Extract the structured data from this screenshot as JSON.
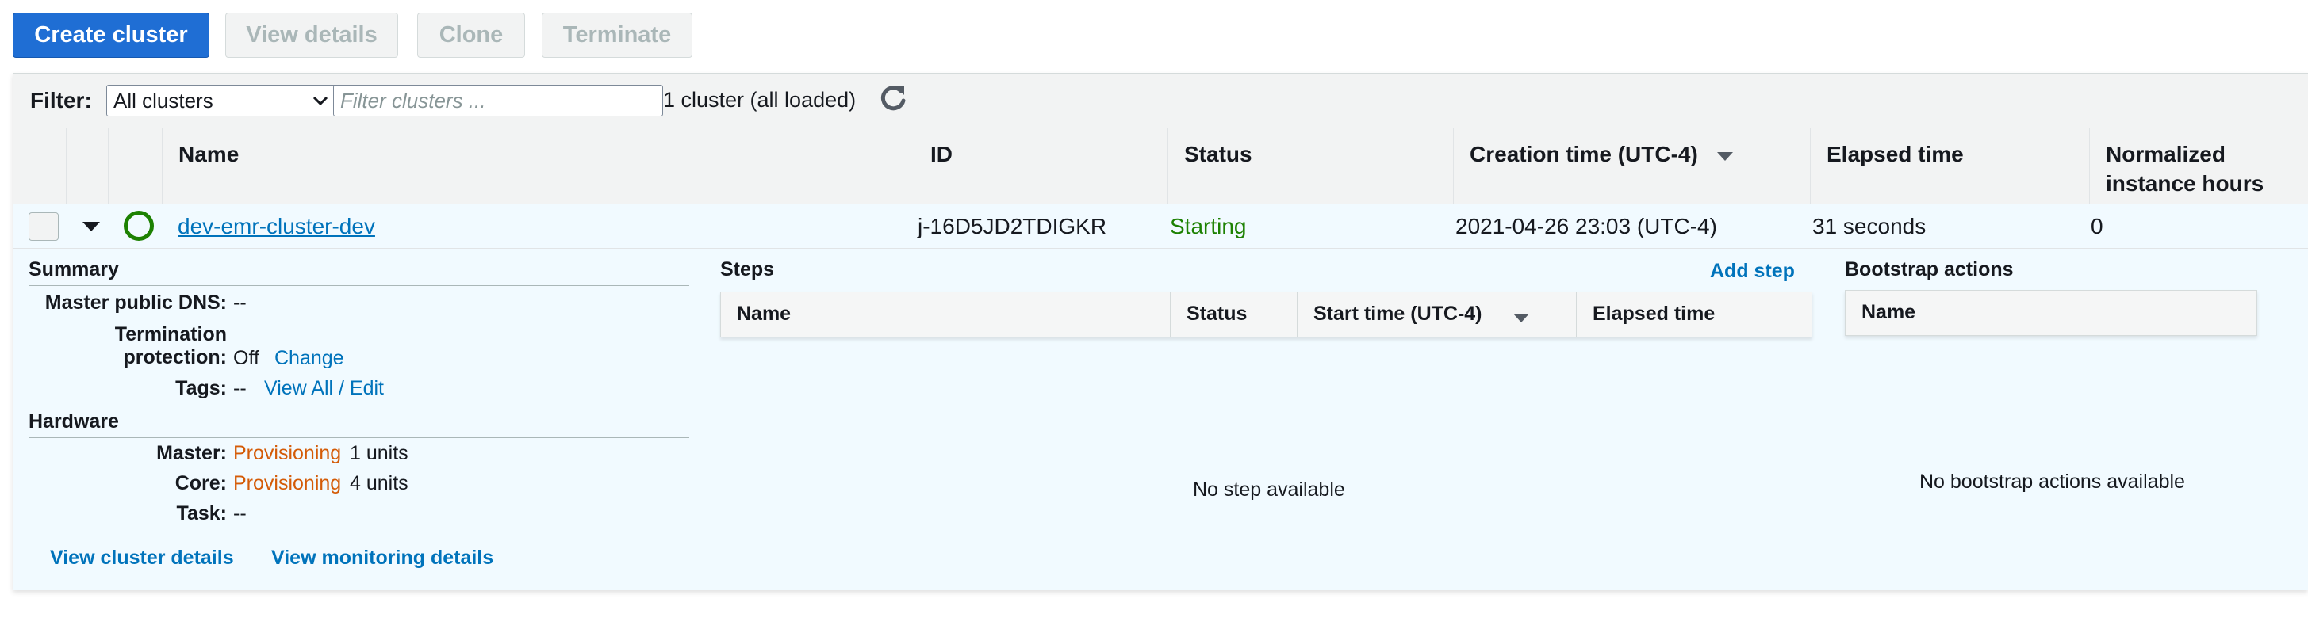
{
  "toolbar": {
    "create_label": "Create cluster",
    "view_details_label": "View details",
    "clone_label": "Clone",
    "terminate_label": "Terminate"
  },
  "filter": {
    "label": "Filter:",
    "select_value": "All clusters",
    "search_placeholder": "Filter clusters ...",
    "count_text": "1 cluster (all loaded)"
  },
  "table": {
    "columns": {
      "name": "Name",
      "id": "ID",
      "status": "Status",
      "creation_time": "Creation time (UTC-4)",
      "elapsed": "Elapsed time",
      "normalized_line1": "Normalized",
      "normalized_line2": "instance hours"
    },
    "row": {
      "name": "dev-emr-cluster-dev",
      "id": "j-16D5JD2TDIGKR",
      "status": "Starting",
      "creation_time": "2021-04-26 23:03 (UTC-4)",
      "elapsed": "31 seconds",
      "normalized_hours": "0"
    }
  },
  "summary": {
    "title": "Summary",
    "master_dns_key": "Master public DNS:",
    "master_dns_val": "--",
    "termination_key_line1": "Termination",
    "termination_key_line2": "protection:",
    "termination_val": "Off",
    "change_link": "Change",
    "tags_key": "Tags:",
    "tags_val": "--",
    "view_all_link": "View All / Edit"
  },
  "hardware": {
    "title": "Hardware",
    "master_key": "Master:",
    "master_status": "Provisioning",
    "master_units": "1 units",
    "core_key": "Core:",
    "core_status": "Provisioning",
    "core_units": "4 units",
    "task_key": "Task:",
    "task_val": "--"
  },
  "links": {
    "cluster_details": "View cluster details",
    "monitoring_details": "View monitoring details"
  },
  "steps": {
    "title": "Steps",
    "add_link": "Add step",
    "col_name": "Name",
    "col_status": "Status",
    "col_start": "Start time (UTC-4)",
    "col_elapsed": "Elapsed time",
    "empty": "No step available"
  },
  "bootstrap": {
    "title": "Bootstrap actions",
    "col_name": "Name",
    "empty": "No bootstrap actions available"
  },
  "colors": {
    "primary": "#1f6ed4",
    "link": "#0073bb",
    "success": "#1d8102",
    "warning": "#d45b07",
    "row_highlight": "#f1faff"
  }
}
